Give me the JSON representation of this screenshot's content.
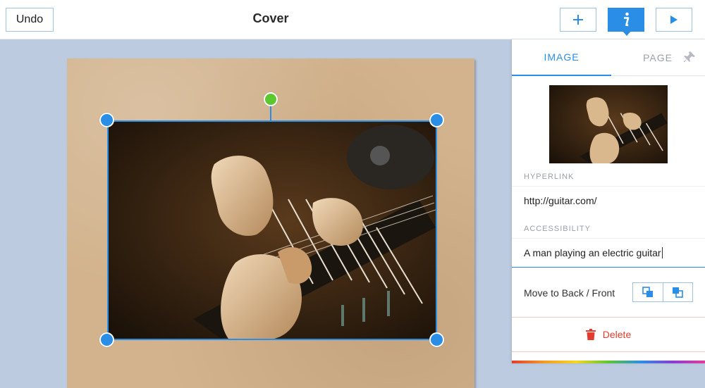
{
  "toolbar": {
    "undo_label": "Undo",
    "title": "Cover",
    "add_icon": "plus-icon",
    "info_icon": "info-icon",
    "play_icon": "play-icon"
  },
  "panel": {
    "tabs": [
      {
        "label": "IMAGE",
        "active": true
      },
      {
        "label": "PAGE",
        "active": false
      }
    ],
    "pin_icon": "pin-icon",
    "hyperlink": {
      "label": "HYPERLINK",
      "value": "http://guitar.com/"
    },
    "accessibility": {
      "label": "ACCESSIBILITY",
      "value": "A man playing an electric guitar"
    },
    "order": {
      "label": "Move to Back / Front",
      "back_icon": "send-to-back-icon",
      "front_icon": "bring-to-front-icon"
    },
    "delete": {
      "label": "Delete",
      "icon": "trash-icon"
    }
  },
  "colors": {
    "accent": "#2a8ee6",
    "rotate_handle": "#5cc72e",
    "danger": "#e33b2e",
    "canvas_bg": "#bccbe0",
    "paper": "#d2b38d"
  }
}
